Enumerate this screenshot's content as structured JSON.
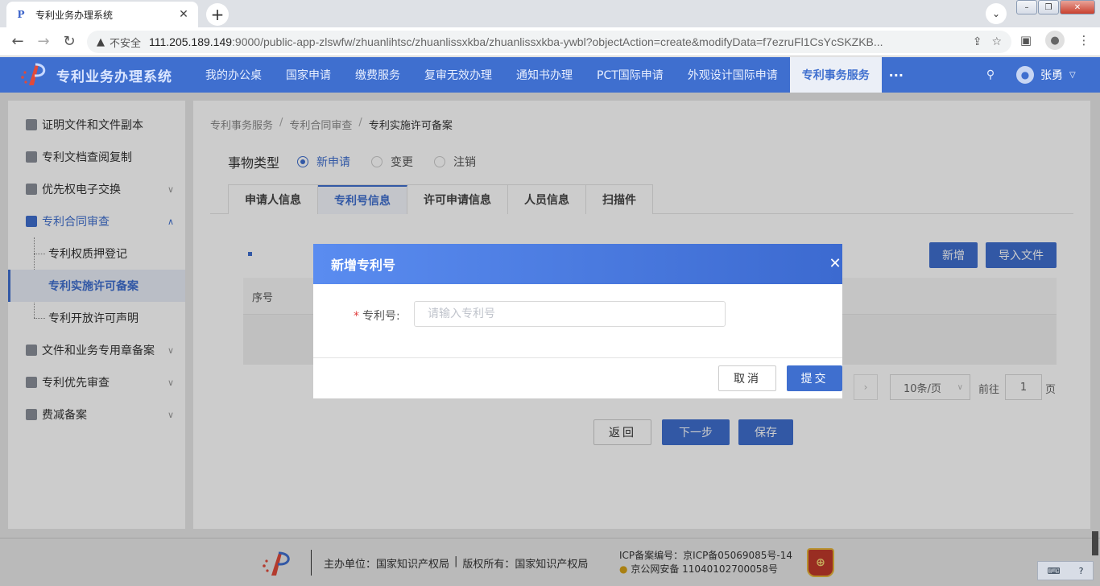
{
  "browser": {
    "tab_title": "专利业务办理系统",
    "tab_close": "✕",
    "new_tab": "+",
    "insecure_label": "不安全",
    "url_host": "111.205.189.149",
    "url_rest": ":9000/public-app-zlswfw/zhuanlihtsc/zhuanlissxkba/zhuanlissxkba-ywbl?objectAction=create&modifyData=f7ezruFl1CsYcSKZKB..."
  },
  "header": {
    "brand": "专利业务办理系统",
    "nav": [
      {
        "label": "我的办公桌"
      },
      {
        "label": "国家申请"
      },
      {
        "label": "缴费服务"
      },
      {
        "label": "复审无效办理"
      },
      {
        "label": "通知书办理"
      },
      {
        "label": "PCT国际申请"
      },
      {
        "label": "外观设计国际申请"
      },
      {
        "label": "专利事务服务"
      }
    ],
    "more": "···",
    "user_name": "张勇"
  },
  "sidebar": {
    "items": [
      {
        "label": "证明文件和文件副本"
      },
      {
        "label": "专利文档查阅复制"
      },
      {
        "label": "优先权电子交换"
      },
      {
        "label": "专利合同审查"
      },
      {
        "label": "文件和业务专用章备案"
      },
      {
        "label": "专利优先审查"
      },
      {
        "label": "费减备案"
      }
    ],
    "subitems": [
      {
        "label": "专利权质押登记"
      },
      {
        "label": "专利实施许可备案"
      },
      {
        "label": "专利开放许可声明"
      }
    ]
  },
  "main": {
    "breadcrumb": [
      "专利事务服务",
      "专利合同审查",
      "专利实施许可备案"
    ],
    "breadcrumb_sep": "/",
    "type_label": "事物类型",
    "radios": [
      {
        "label": "新申请",
        "checked": true
      },
      {
        "label": "变更",
        "checked": false
      },
      {
        "label": "注销",
        "checked": false
      }
    ],
    "tabs": [
      {
        "label": "申请人信息"
      },
      {
        "label": "专利号信息"
      },
      {
        "label": "许可申请信息"
      },
      {
        "label": "人员信息"
      },
      {
        "label": "扫描件"
      }
    ],
    "active_tab": "专利号信息",
    "add_button": "新增",
    "import_button": "导入文件",
    "table_header_index": "序号",
    "pager": {
      "next": "›",
      "page_size": "10条/页",
      "goto_label": "前往",
      "goto_value": "1",
      "page_unit": "页"
    },
    "back_button": "返回",
    "next_button": "下一步",
    "save_button": "保存"
  },
  "modal": {
    "title": "新增专利号",
    "close": "✕",
    "required_mark": "*",
    "field_label": "专利号:",
    "field_placeholder": "请输入专利号",
    "field_value": "",
    "cancel_button": "取消",
    "submit_button": "提交"
  },
  "footer": {
    "host": "主办单位：国家知识产权局",
    "copyright": "版权所有：国家知识产权局",
    "icp": "ICP备案编号：京ICP备05069085号-14",
    "police": "京公网安备 11040102700058号"
  },
  "colors": {
    "primary": "#3f6fcf",
    "header_bg": "#3f6fcf",
    "modal_header": "#4f7fe6"
  }
}
